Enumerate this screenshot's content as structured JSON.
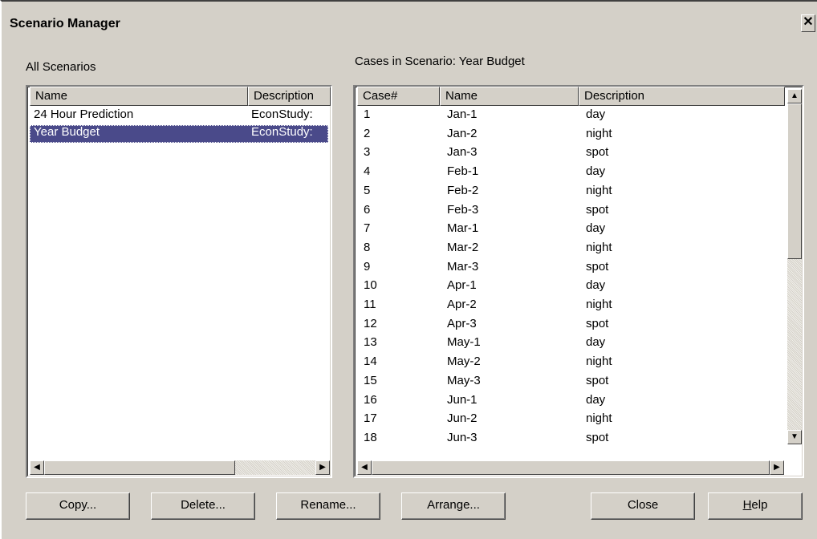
{
  "window": {
    "title": "Scenario Manager",
    "close_glyph": "✕"
  },
  "scenarios": {
    "label": "All Scenarios",
    "columns": [
      "Name",
      "Description"
    ],
    "rows": [
      {
        "name": "24 Hour Prediction",
        "description": "EconStudy:"
      },
      {
        "name": "Year Budget",
        "description": "EconStudy:",
        "selected": true
      }
    ]
  },
  "cases": {
    "label": "Cases in Scenario: Year Budget",
    "columns": [
      "Case#",
      "Name",
      "Description"
    ],
    "rows": [
      {
        "case": "1",
        "name": "Jan-1",
        "description": "day"
      },
      {
        "case": "2",
        "name": "Jan-2",
        "description": "night"
      },
      {
        "case": "3",
        "name": "Jan-3",
        "description": "spot"
      },
      {
        "case": "4",
        "name": "Feb-1",
        "description": "day"
      },
      {
        "case": "5",
        "name": "Feb-2",
        "description": "night"
      },
      {
        "case": "6",
        "name": "Feb-3",
        "description": "spot"
      },
      {
        "case": "7",
        "name": "Mar-1",
        "description": "day"
      },
      {
        "case": "8",
        "name": "Mar-2",
        "description": "night"
      },
      {
        "case": "9",
        "name": "Mar-3",
        "description": "spot"
      },
      {
        "case": "10",
        "name": "Apr-1",
        "description": "day"
      },
      {
        "case": "11",
        "name": "Apr-2",
        "description": "night"
      },
      {
        "case": "12",
        "name": "Apr-3",
        "description": "spot"
      },
      {
        "case": "13",
        "name": "May-1",
        "description": "day"
      },
      {
        "case": "14",
        "name": "May-2",
        "description": "night"
      },
      {
        "case": "15",
        "name": "May-3",
        "description": "spot"
      },
      {
        "case": "16",
        "name": "Jun-1",
        "description": "day"
      },
      {
        "case": "17",
        "name": "Jun-2",
        "description": "night"
      },
      {
        "case": "18",
        "name": "Jun-3",
        "description": "spot"
      }
    ]
  },
  "buttons": {
    "copy": "Copy...",
    "delete": "Delete...",
    "rename": "Rename...",
    "arrange": "Arrange...",
    "close": "Close",
    "help_mnemonic": "H",
    "help_rest": "elp"
  },
  "icons": {
    "up": "▲",
    "down": "▼",
    "left": "◀",
    "right": "▶"
  },
  "colors": {
    "selection": "#4a4a8a",
    "face": "#d4d0c8"
  }
}
